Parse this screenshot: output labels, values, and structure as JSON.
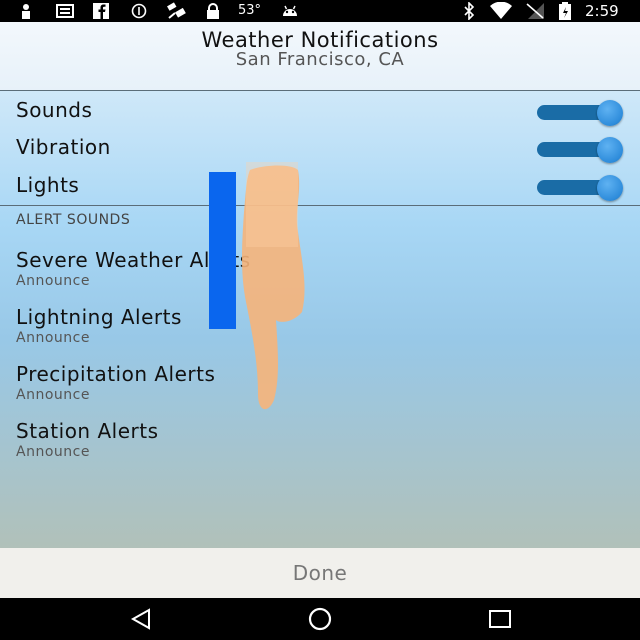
{
  "status_bar": {
    "temperature": "53°",
    "time": "2:59",
    "left_icons": [
      "person-icon",
      "message-icon",
      "facebook-icon",
      "info-icon",
      "satellite-icon",
      "lock-icon"
    ],
    "right_icons": [
      "bluetooth-icon",
      "wifi-icon",
      "signal-icon",
      "battery-icon"
    ]
  },
  "header": {
    "title": "Weather Notifications",
    "subtitle": "San Francisco, CA"
  },
  "toggles": [
    {
      "label": "Sounds",
      "on": true
    },
    {
      "label": "Vibration",
      "on": true
    },
    {
      "label": "Lights",
      "on": true
    }
  ],
  "alert_sounds": {
    "section_title": "ALERT SOUNDS",
    "items": [
      {
        "name": "Severe Weather Alerts",
        "value": "Announce"
      },
      {
        "name": "Lightning Alerts",
        "value": "Announce"
      },
      {
        "name": "Precipitation Alerts",
        "value": "Announce"
      },
      {
        "name": "Station Alerts",
        "value": "Announce"
      }
    ]
  },
  "footer": {
    "done_label": "Done"
  },
  "nav_bar": {
    "buttons": [
      "back-icon",
      "home-icon",
      "recents-icon"
    ]
  },
  "colors": {
    "switch_track": "#1a6ca6",
    "switch_thumb": "#2e8cdb",
    "overlay_bar": "#0a66ee",
    "overlay_hand": "#f6b47a"
  }
}
